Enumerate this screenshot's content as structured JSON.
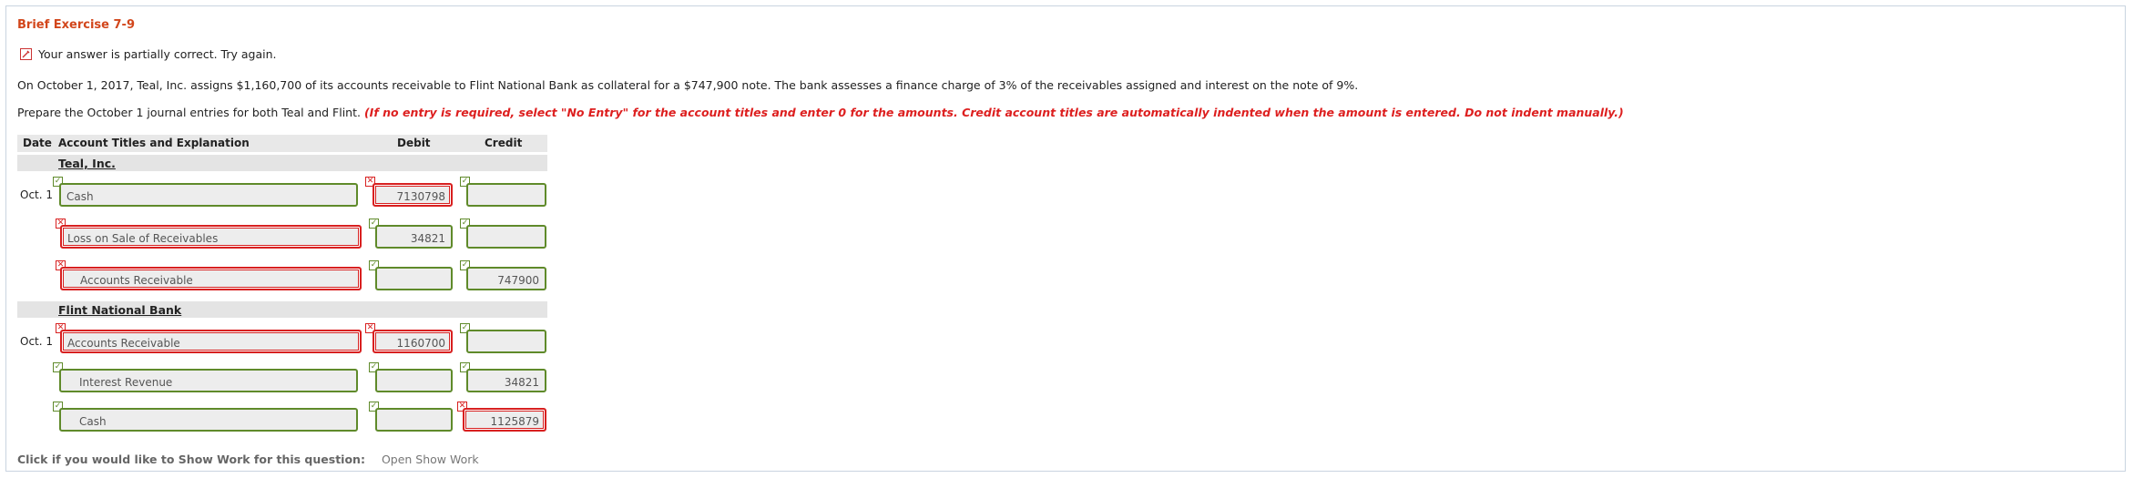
{
  "exercise": {
    "title": "Brief Exercise 7-9"
  },
  "status": {
    "message": "Your answer is partially correct.  Try again."
  },
  "question": {
    "text": "On October 1, 2017, Teal, Inc. assigns $1,160,700 of its accounts receivable to Flint National Bank as collateral for a $747,900 note. The bank assesses a finance charge of 3% of the receivables assigned and interest on the note of 9%.",
    "prompt": "Prepare the October 1 journal entries for both Teal and Flint.",
    "instructions": "(If no entry is required, select \"No Entry\" for the account titles and enter 0 for the amounts. Credit account titles are automatically indented when the amount is entered. Do not indent manually.)"
  },
  "table": {
    "headers": {
      "date": "Date",
      "account": "Account Titles and Explanation",
      "debit": "Debit",
      "credit": "Credit"
    },
    "sections": [
      {
        "name": "Teal, Inc.",
        "date": "Oct. 1",
        "rows": [
          {
            "account": "Cash",
            "debit": "7130798",
            "credit": ""
          },
          {
            "account": "Loss on Sale of Receivables",
            "debit": "34821",
            "credit": ""
          },
          {
            "account": "Accounts Receivable",
            "debit": "",
            "credit": "747900"
          }
        ]
      },
      {
        "name": "Flint National Bank",
        "date": "Oct. 1",
        "rows": [
          {
            "account": "Accounts Receivable",
            "debit": "1160700",
            "credit": ""
          },
          {
            "account": "Interest Revenue",
            "debit": "",
            "credit": "34821"
          },
          {
            "account": "Cash",
            "debit": "",
            "credit": "1125879"
          }
        ]
      }
    ]
  },
  "show_work": {
    "label": "Click if you would like to Show Work for this question:",
    "link": "Open Show Work"
  },
  "colors": {
    "title": "#d2461b",
    "correct": "#5f8a2a",
    "incorrect": "#d82020",
    "instructions": "#dd1f1f"
  }
}
